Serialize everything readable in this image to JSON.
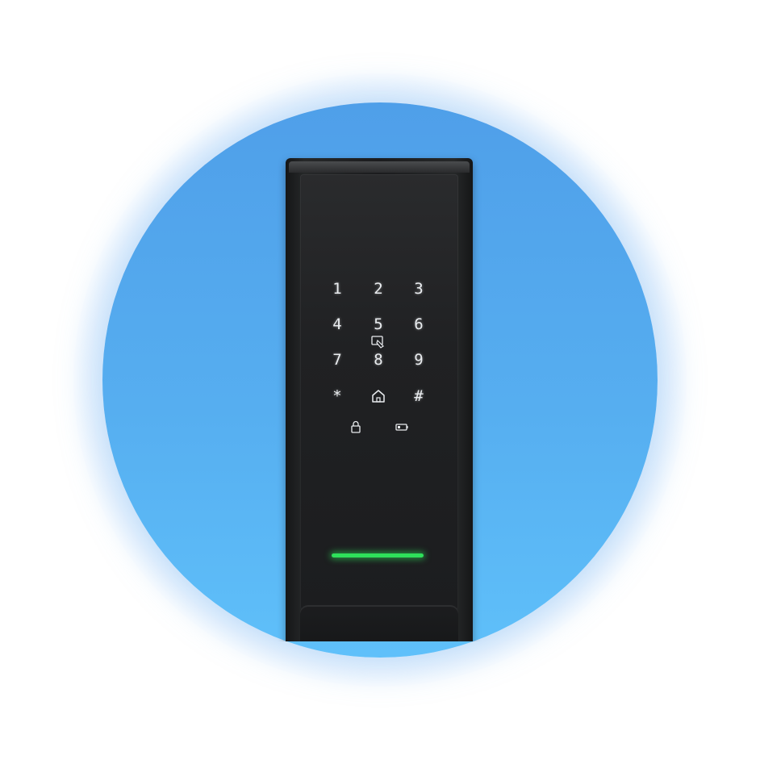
{
  "keypad": {
    "rows": [
      [
        "1",
        "2",
        "3"
      ],
      [
        "4",
        "5",
        "6"
      ],
      [
        "7",
        "8",
        "9"
      ],
      [
        "*",
        "",
        "#"
      ]
    ]
  },
  "icons": {
    "card_reader": "card-reader-icon",
    "home": "home-icon",
    "lock": "lock-icon",
    "battery": "battery-icon"
  },
  "colors": {
    "background_disc": "#56aef0",
    "lock_body": "#1f2022",
    "key_glow": "#e9ecef",
    "status_led": "#2ee05a"
  }
}
